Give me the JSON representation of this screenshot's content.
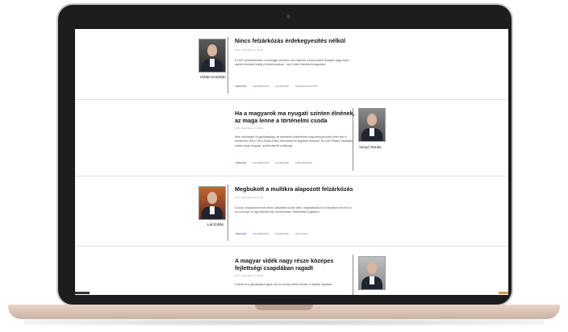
{
  "articles": [
    {
      "title": "Nincs felzárkózás érdekegyesítés nélkül",
      "date": "2017. december 13. 09:00",
      "excerpt": "A GDP-növekedésében a térséggel szemben nem sikerült, a közép-keleti térségek nagy része szintén lemaradt eddig a felzárkózásban... írja Orbán Krisztián közgazdász.",
      "author": "Orbán Krisztián",
      "tags": [
        "VISEGRÁD",
        "FELZÁRKÓZÁS",
        "EU-BÜDZSÉ",
        "GAZDASÁGPOLITIKA"
      ]
    },
    {
      "title": "Ha a magyarok ma nyugati szinten élnének, az maga lenne a történelmi csoda",
      "date": "2017. december 11. 08:00",
      "excerpt": "Nem szükséges hit gazdaságilag, de lépéseket tüntethetnek mag ismerjük mikor lehet lesz a menekülés, Berci Toll a Közép-Eladó Kereskedő és Egyetem docense. És a 50 Philipp Publikálás címére olyan dolgunk, amiről sikerült a változás.",
      "author": "Vonyó Tamás",
      "tags": [
        "VISEGRÁD",
        "FELZÁRKÓZÁS",
        "EU-BÜDZSÉ",
        "KÖZGAZDASÁG"
      ]
    },
    {
      "title": "Megbukott a multikra alapozott felzárkózás",
      "date": "2017. december 04. 07:00",
      "excerpt": "A rövid, szeptemberi évek lévén, kifejthetni is bele telek, megfejtettünk és a helyzetet nem érzi el az a könnyű és úgy történik vele szerencsésen. Befektetést a gyárhoz.",
      "author": "Lał Zoltán",
      "tags": [
        "VISEGRÁD",
        "FELZÁRKÓZÁS",
        "EU-BÜDZSÉ",
        "SZLOVÁKIA"
      ]
    },
    {
      "title": "A magyar vidék nagy része közepes fejlettségi csapdában ragadt",
      "date": "2017. november 27. 08:00",
      "excerpt": "A falusi és a gazdaságok egyre sok az ország vidéki részein, a legtöbb régióban,",
      "author": "",
      "tags": []
    }
  ]
}
